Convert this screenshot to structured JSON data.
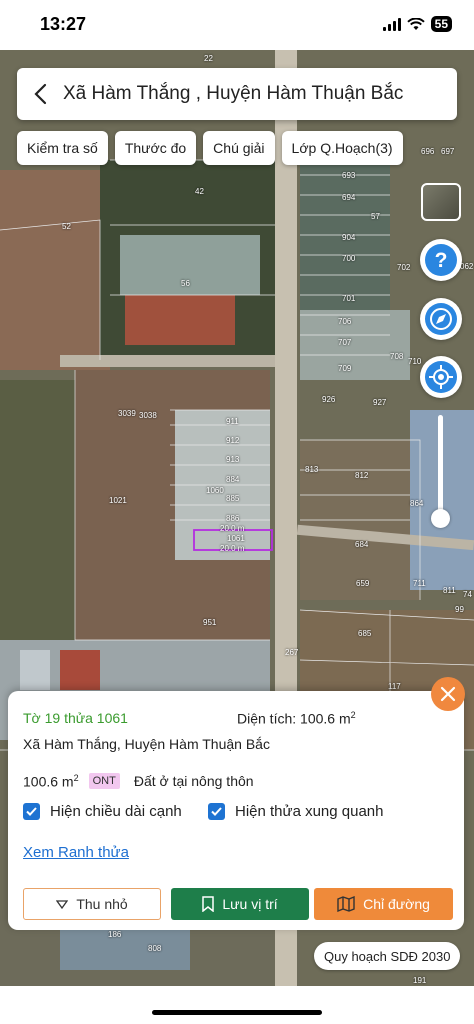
{
  "status_bar": {
    "time": "13:27",
    "battery": "55"
  },
  "header": {
    "title": "Xã Hàm Thắng , Huyện Hàm Thuận Bắc"
  },
  "toolbar": {
    "items": [
      "Kiểm tra số",
      "Thước đo",
      "Chú giải",
      "Lớp Q.Hoạch(3)"
    ]
  },
  "map": {
    "parcel_labels": [
      "22",
      "42",
      "52",
      "56",
      "693",
      "694",
      "57",
      "904",
      "700",
      "702",
      "062",
      "701",
      "706",
      "707",
      "708",
      "710",
      "709",
      "926",
      "927",
      "911",
      "912",
      "913",
      "884",
      "885",
      "1060",
      "886",
      "1061",
      "3039",
      "3038",
      "1021",
      "813",
      "812",
      "864",
      "684",
      "659",
      "711",
      "811",
      "74",
      "99",
      "951",
      "267",
      "685",
      "117",
      "186",
      "808",
      "191",
      "696",
      "697"
    ],
    "measurement_labels": [
      "20.0 m",
      "1061",
      "20.0 m"
    ]
  },
  "panel": {
    "title": "Tờ 19 thửa 1061",
    "area_label": "Diện tích: 100.6 m",
    "area_sup": "2",
    "location": "Xã Hàm Thắng, Huyện Hàm Thuận Bắc",
    "row_area": "100.6 m",
    "row_sup": "2",
    "land_code": "ONT",
    "land_use": "Đất ở tại nông thôn",
    "check1": "Hiện chiều dài cạnh",
    "check2": "Hiện thửa xung quanh",
    "link": "Xem Ranh thửa",
    "btn_collapse": "Thu nhỏ",
    "btn_save": "Lưu vị trí",
    "btn_directions": "Chỉ đường"
  },
  "chip": "Quy hoạch SDĐ 2030"
}
